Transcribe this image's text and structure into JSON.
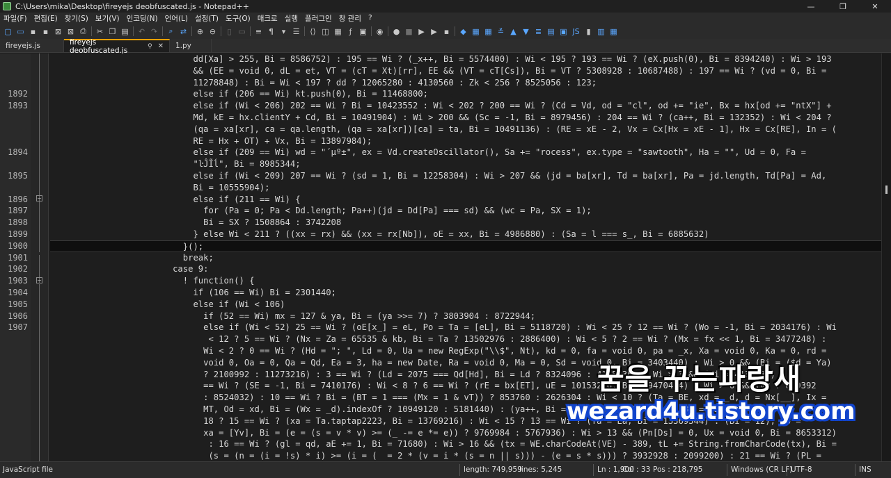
{
  "window": {
    "title": "C:\\Users\\mika\\Desktop\\fireyejs deobfuscated.js - Notepad++",
    "controls": [
      "—",
      "❐",
      "✕"
    ]
  },
  "menu": [
    "파일(F)",
    "편집(E)",
    "찾기(S)",
    "보기(V)",
    "인코딩(N)",
    "언어(L)",
    "설정(T)",
    "도구(O)",
    "매크로",
    "실행",
    "플러그인",
    "창 관리",
    "?"
  ],
  "tabs": [
    {
      "label": "fireyejs.js",
      "active": false
    },
    {
      "label": "fireyejs deobfuscated.js",
      "active": true
    },
    {
      "label": "1.py",
      "active": false
    }
  ],
  "editor": {
    "lines": [
      {
        "n": "",
        "t": "                            dd[Xa] > 255, Bi = 8586752) : 195 == Wi ? (_x++, Bi = 5574400) : Wi < 195 ? 193 == Wi ? (eX.push(0), Bi = 8394240) : Wi > 193"
      },
      {
        "n": "",
        "t": "                            && (EE = void 0, dL = et, VT = (cT = Xt)[rr], EE && (VT = cT[Cs]), Bi = VT ? 5308928 : 10687488) : 197 == Wi ? (vd = 0, Bi ="
      },
      {
        "n": "",
        "t": "                            11278848) : Bi = Wi < 197 ? dd ? 12065280 : 4130560 : Zk < 256 ? 8525056 : 123;"
      },
      {
        "n": "1892",
        "t": "                            else if (206 == Wi) kt.push(0), Bi = 11468800;"
      },
      {
        "n": "1893",
        "t": "                            else if (Wi < 206) 202 == Wi ? Bi = 10423552 : Wi < 202 ? 200 == Wi ? (Cd = Vd, od = \"cl\", od += \"ie\", Bx = hx[od += \"ntX\"] +"
      },
      {
        "n": "",
        "t": "                            Md, kE = hx.clientY + Cd, Bi = 10491904) : Wi > 200 && (Sc = -1, Bi = 8979456) : 204 == Wi ? (ca++, Bi = 132352) : Wi < 204 ?"
      },
      {
        "n": "",
        "t": "                            (qa = xa[xr], ca = qa.length, (qa = xa[xr])[ca] = ta, Bi = 10491136) : (RE = xE - 2, Vx = Cx[Hx = xE - 1], Hx = Cx[RE], In = ("
      },
      {
        "n": "",
        "t": "                            RE = Hx + OT) + Vx, Bi = 13897984);"
      },
      {
        "n": "1894",
        "t": "                            else if (209 == Wi) wd = \"´µº±\", ex = Vd.createOscillator(), Sa += \"rocess\", ex.type = \"sawtooth\", Ha = \"\", Ud = 0, Fa ="
      },
      {
        "n": "",
        "t": "                            \"ŀĴĨĺ\", Bi = 8985344;"
      },
      {
        "n": "1895",
        "t": "                            else if (Wi < 209) 207 == Wi ? (sd = 1, Bi = 12258304) : Wi > 207 && (jd = ba[xr], Td = ba[xr], Pa = jd.length, Td[Pa] = Ad,"
      },
      {
        "n": "",
        "t": "                            Bi = 10555904);"
      },
      {
        "n": "1896",
        "t": "                            else if (211 == Wi) {"
      },
      {
        "n": "1897",
        "t": "                              for (Pa = 0; Pa < Dd.length; Pa++)(jd = Dd[Pa] === sd) && (wc = Pa, SX = 1);"
      },
      {
        "n": "1898",
        "t": "                              Bi = SX ? 1508864 : 3742208"
      },
      {
        "n": "1899",
        "t": "                            } else Wi < 211 ? ((xx = rx) && (xx = rx[Nb]), oE = xx, Bi = 4986880) : (Sa = l === s_, Bi = 6885632)"
      },
      {
        "n": "1900",
        "t": "                          }();"
      },
      {
        "n": "1901",
        "t": "                          break;"
      },
      {
        "n": "1902",
        "t": "                        case 9:"
      },
      {
        "n": "1903",
        "t": "                          ! function() {"
      },
      {
        "n": "1904",
        "t": "                            if (106 == Wi) Bi = 2301440;"
      },
      {
        "n": "1905",
        "t": "                            else if (Wi < 106)"
      },
      {
        "n": "1906",
        "t": "                              if (52 == Wi) mx = 127 & ya, Bi = (ya >>= 7) ? 3803904 : 8722944;"
      },
      {
        "n": "1907",
        "t": "                              else if (Wi < 52) 25 == Wi ? (oE[x_] = eL, Po = Ta = [eL], Bi = 5118720) : Wi < 25 ? 12 == Wi ? (Wo = -1, Bi = 2034176) : Wi"
      },
      {
        "n": "",
        "t": "                               < 12 ? 5 == Wi ? (Nx = Za = 65535 & kb, Bi = Ta ? 13502976 : 2886400) : Wi < 5 ? 2 == Wi ? (Mx = fx << 1, Bi = 3477248) :"
      },
      {
        "n": "",
        "t": "                              Wi < 2 ? 0 == Wi ? (Hd = \"; \", Ld = 0, Ua = new RegExp(\"\\\\$\", Nt), kd = 0, fa = void 0, pa = _x, Xa = void 0, Ka = 0, rd ="
      },
      {
        "n": "",
        "t": "                              void 0, Oa = 0, Qa = Qd, Ea = 3, ha = new Date, Ra = void 0, Ma = 0, Sd = void 0, Bi = 3403440) : Wi > 0 && (Bi = ($d = Ya)"
      },
      {
        "n": "",
        "t": "                              ? 2100992 : 11273216) : 3 == Wi ? (Ld = 2075 === Qd[Hd], Bi = Ld ? 8324096 : 4135936) : Wi > 3 && (Bi = 4135936) : 8"
      },
      {
        "n": "",
        "t": "                              == Wi ? (SE = -1, Bi = 7410176) : Wi < 8 ? 6 == Wi ? (rE = bx[ET], uE = 10153216, Bi = 9470464) : Wi > 6 && (vx ? 859392"
      },
      {
        "n": "",
        "t": "                              : 8524032) : 10 == Wi ? Bi = (BT = 1 === (Mx = 1 & vT)) ? 853760 : 2626304 : Wi < 10 ? (Ta = BE, xd = _d, d = Nx[__], Ix ="
      },
      {
        "n": "",
        "t": "                              MT, Od = xd, Bi = (Wx = _d).indexOf ? 10949120 : 5181440) : (ya++, Bi = 5181440) : 18 == Wi ? Bi = 5308416 : Wi <"
      },
      {
        "n": "",
        "t": "                              18 ? 15 == Wi ? (xa = Ta.taptap2223, Bi = 13769216) : Wi < 15 ? 13 == Wi ? (Ta = Ea, Bi = 13369344) : (Bi = 12), vp ="
      },
      {
        "n": "",
        "t": "                              xa = [Yv], Bi = (e = (s = v * v) >= (_ -= e *= e)) ? 9769984 : 5767936) : Wi > 13 && (Pn[Ds] = 0, Ux = void 0, Bi = 8653312)"
      },
      {
        "n": "",
        "t": "                               : 16 == Wi ? (gl = qd, aE += 1, Bi = 71680) : Wi > 16 && (tx = WE.charCodeAt(VE) - 389, tL += String.fromCharCode(tx), Bi ="
      },
      {
        "n": "",
        "t": "                               (s = (n = (i = !s) * i) >= (i = (  = 2 * (v = i * (s = n || s))) - (e = s * s))) ? 3932928 : 2099200) : 21 == Wi ? (PL ="
      }
    ]
  },
  "watermark": {
    "korean": "꿈을 꾸는파랑새",
    "url": "wezard4u.tistory.com"
  },
  "status": {
    "filetype": "JavaScript file",
    "length": "length: 749,959",
    "lines": "lines: 5,245",
    "ln": "Ln : 1,900",
    "col": "Col : 33",
    "pos": "Pos : 218,795",
    "eol": "Windows (CR LF)",
    "encoding": "UTF-8",
    "mode": "INS"
  }
}
